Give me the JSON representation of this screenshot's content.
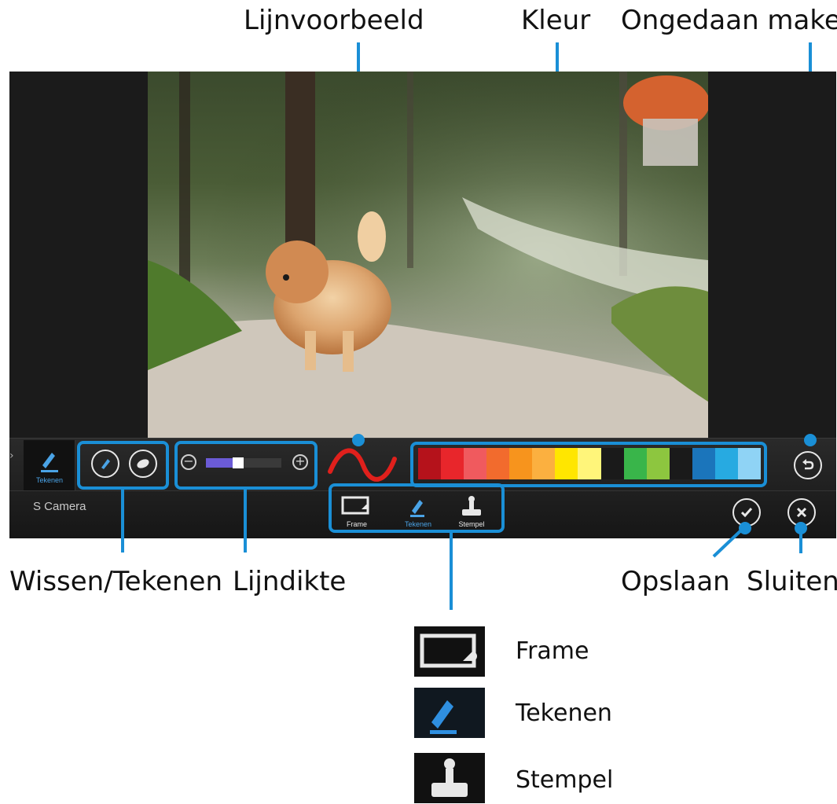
{
  "callouts": {
    "line_preview": "Lijnvoorbeeld",
    "color": "Kleur",
    "undo": "Ongedaan maken",
    "erase_draw": "Wissen/Tekenen",
    "line_thickness": "Lijndikte",
    "save": "Opslaan",
    "close": "Sluiten"
  },
  "toolbar": {
    "app_name": "S Camera",
    "tabs": [
      {
        "label": "Frame",
        "icon": "frame-icon"
      },
      {
        "label": "Tekenen",
        "icon": "pen-icon"
      },
      {
        "label": "Stempel",
        "icon": "stamp-icon"
      }
    ],
    "left_mode_label": "Tekenen",
    "line_thickness_level": 0.35,
    "palette": [
      "#b5121b",
      "#e8262b",
      "#f05a5e",
      "#f26b2d",
      "#f7941d",
      "#fbb040",
      "#ffe600",
      "#fff57a",
      "#1a1a1a",
      "#39b54a",
      "#8dc63f",
      "#1a1a1a",
      "#1b75bb",
      "#27aae1",
      "#8fd3f5"
    ]
  },
  "legend": [
    {
      "label": "Frame",
      "icon": "frame-icon"
    },
    {
      "label": "Tekenen",
      "icon": "pen-icon"
    },
    {
      "label": "Stempel",
      "icon": "stamp-icon"
    }
  ],
  "colors": {
    "accent": "#1a8fd6",
    "toolbar_bg": "#1b1b1b",
    "preview_stroke": "#e0201c"
  }
}
